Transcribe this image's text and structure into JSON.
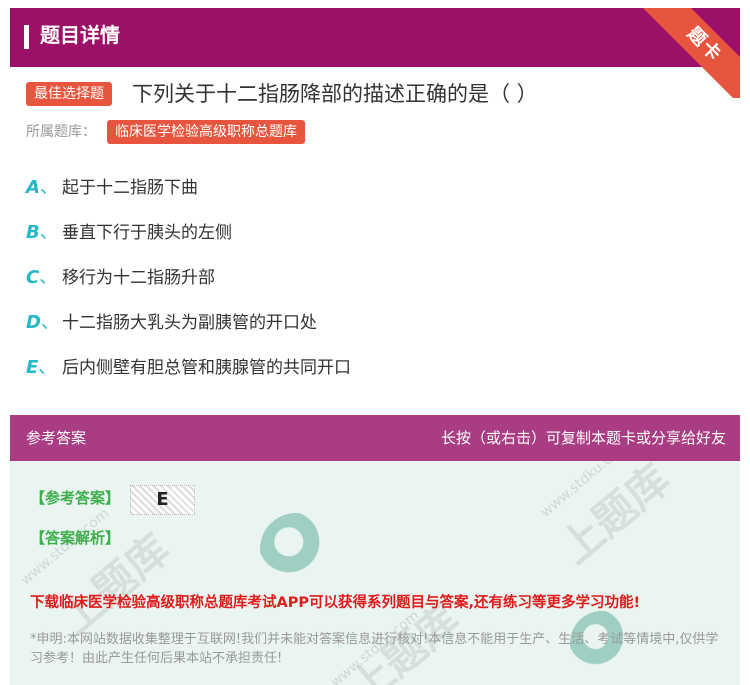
{
  "header": {
    "title": "题目详情",
    "ribbon": "题卡"
  },
  "question": {
    "tag": "最佳选择题",
    "text": "下列关于十二指肠降部的描述正确的是（ ）",
    "bank_label": "所属题库：",
    "bank_name": "临床医学检验高级职称总题库"
  },
  "options": [
    {
      "letter": "A",
      "sep": "、",
      "text": "起于十二指肠下曲"
    },
    {
      "letter": "B",
      "sep": "、",
      "text": "垂直下行于胰头的左侧"
    },
    {
      "letter": "C",
      "sep": "、",
      "text": "移行为十二指肠升部"
    },
    {
      "letter": "D",
      "sep": "、",
      "text": "十二指肠大乳头为副胰管的开口处"
    },
    {
      "letter": "E",
      "sep": "、",
      "text": "后内侧壁有胆总管和胰腺管的共同开口"
    }
  ],
  "answer": {
    "section_title": "参考答案",
    "share_hint": "长按（或右击）可复制本题卡或分享给好友",
    "answer_label": "【参考答案】",
    "answer_value": "E",
    "analysis_label": "【答案解析】",
    "promo": "下载临床医学检验高级职称总题库考试APP可以获得系列题目与答案,还有练习等更多学习功能!",
    "disclaimer": "*申明:本网站数据收集整理于互联网!我们并未能对答案信息进行核对!本信息不能用于生产、生活、考试等情境中,仅供学习参考！由此产生任何后果本站不承担责任!"
  },
  "watermark": {
    "site": "www.stdku.com",
    "brand": "上题库"
  },
  "colors": {
    "header": "#9c1168",
    "ribbon": "#e8553f",
    "tag": "#e8553f",
    "option_letter": "#26b8c4",
    "answer_head": "#a93c83",
    "answer_bg": "#eaf5f2",
    "answer_label": "#3fae4c",
    "promo": "#e01b1b"
  }
}
